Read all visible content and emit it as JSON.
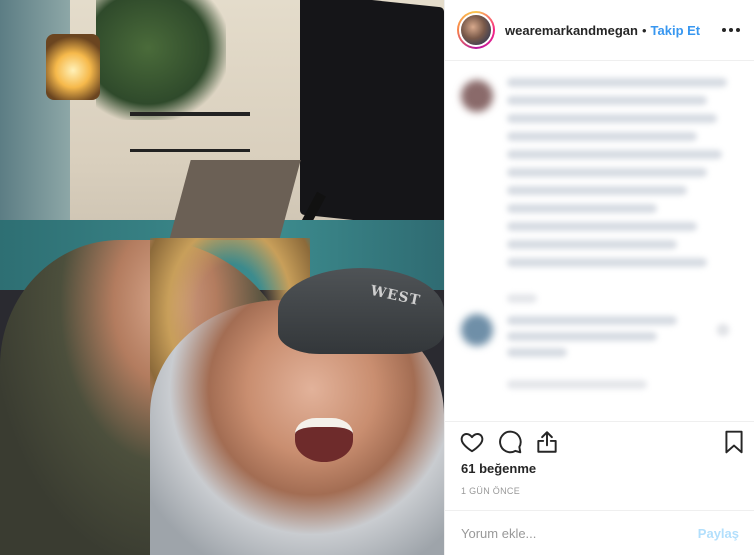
{
  "post": {
    "username": "wearemarkandmegan",
    "separator": "•",
    "follow_label": "Takip Et",
    "likes_text": "61 beğenme",
    "timestamp": "1 GÜN ÖNCE",
    "cap_text": "WEST"
  },
  "comment_box": {
    "placeholder": "Yorum ekle...",
    "post_label": "Paylaş"
  },
  "icons": {
    "like": "heart-icon",
    "comment": "speech-bubble-icon",
    "share": "share-icon",
    "save": "bookmark-icon",
    "more": "more-options-icon"
  },
  "colors": {
    "accent": "#3897f0",
    "post_disabled": "#b2dffc",
    "text": "#262626",
    "muted": "#999999"
  }
}
